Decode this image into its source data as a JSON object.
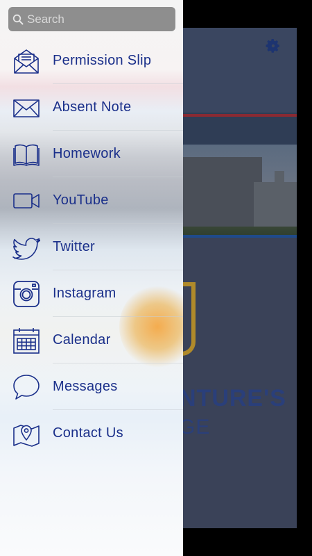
{
  "search": {
    "placeholder": "Search"
  },
  "menu": [
    {
      "label": "Permission Slip",
      "icon": "envelope-open-icon"
    },
    {
      "label": "Absent Note",
      "icon": "envelope-icon"
    },
    {
      "label": "Homework",
      "icon": "book-icon"
    },
    {
      "label": "YouTube",
      "icon": "video-camera-icon"
    },
    {
      "label": "Twitter",
      "icon": "twitter-bird-icon"
    },
    {
      "label": "Instagram",
      "icon": "instagram-camera-icon"
    },
    {
      "label": "Calendar",
      "icon": "calendar-icon"
    },
    {
      "label": "Messages",
      "icon": "chat-bubble-icon"
    },
    {
      "label": "Contact Us",
      "icon": "map-pin-icon"
    }
  ],
  "background": {
    "title_line1": "NTURE'S",
    "title_line2": "GE"
  },
  "colors": {
    "accent": "#1a2f8a",
    "search_bg": "#8e8e8e"
  }
}
